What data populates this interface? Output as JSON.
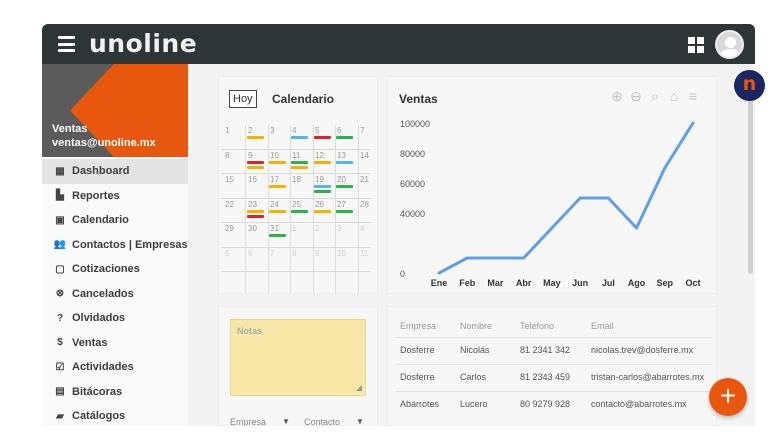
{
  "app": {
    "brand": "unoline"
  },
  "user": {
    "name": "Ventas",
    "email": "ventas@unoline.mx"
  },
  "sidebar": {
    "items": [
      {
        "label": "Dashboard",
        "icon": "dashboard-icon",
        "active": true
      },
      {
        "label": "Reportes",
        "icon": "bar-chart-icon"
      },
      {
        "label": "Calendario",
        "icon": "calendar-icon"
      },
      {
        "label": "Contactos | Empresas",
        "icon": "people-icon"
      },
      {
        "label": "Cotizaciones",
        "icon": "document-icon"
      },
      {
        "label": "Cancelados",
        "icon": "cancel-circle-icon"
      },
      {
        "label": "Olvidados",
        "icon": "question-icon"
      },
      {
        "label": "Ventas",
        "icon": "dollar-icon"
      },
      {
        "label": "Actividades",
        "icon": "checkbox-icon"
      },
      {
        "label": "Bitácoras",
        "icon": "list-icon"
      },
      {
        "label": "Catálogos",
        "icon": "folder-icon"
      }
    ]
  },
  "calendar": {
    "today_label": "Hoy",
    "title": "Calendario",
    "weeks": [
      [
        "1",
        "2",
        "3",
        "4",
        "5",
        "6",
        "7"
      ],
      [
        "8",
        "9",
        "10",
        "11",
        "12",
        "13",
        "14"
      ],
      [
        "15",
        "16",
        "17",
        "18",
        "19",
        "20",
        "21"
      ],
      [
        "22",
        "23",
        "24",
        "25",
        "26",
        "27",
        "28"
      ],
      [
        "29",
        "30",
        "31",
        "1",
        "2",
        "3",
        "4"
      ],
      [
        "5",
        "6",
        "7",
        "8",
        "9",
        "10",
        "11"
      ]
    ],
    "colors": {
      "yellow": "#f0b400",
      "blue": "#52b6e6",
      "red": "#d9262e",
      "green": "#2bb24c"
    }
  },
  "sales": {
    "title": "Ventas",
    "tool_icons": [
      "zoom-in-icon",
      "zoom-out-icon",
      "zoom-select-icon",
      "home-icon",
      "menu-icon"
    ]
  },
  "chart_data": {
    "type": "line",
    "categories": [
      "Ene",
      "Feb",
      "Mar",
      "Abr",
      "May",
      "Jun",
      "Jul",
      "Ago",
      "Sep",
      "Oct"
    ],
    "values": [
      0,
      10000,
      10000,
      10000,
      30000,
      50000,
      50000,
      30000,
      70000,
      100000
    ],
    "ylim": [
      0,
      100000
    ],
    "yticks": [
      0,
      40000,
      60000,
      80000,
      100000
    ],
    "grid": false,
    "color": "#5ea0e8"
  },
  "notes": {
    "label": "Notas",
    "select1": "Empresa",
    "select2": "Contacto"
  },
  "table": {
    "headers": [
      "Empresa",
      "Nombre",
      "Teléfono",
      "Email"
    ],
    "rows": [
      [
        "Dosferre",
        "Nicolás",
        "81 2341 342",
        "nicolas.trev@dosferre.mx"
      ],
      [
        "Dosferre",
        "Carlos",
        "81 2343 459",
        "tristan-carlos@abarrotes.mx"
      ],
      [
        "Abarrotes",
        "Lucero",
        "80 9279 928",
        "contacto@abarrotes.mx"
      ]
    ]
  },
  "logo_badge": {
    "letter": "n"
  },
  "fab": {
    "label": "+"
  }
}
